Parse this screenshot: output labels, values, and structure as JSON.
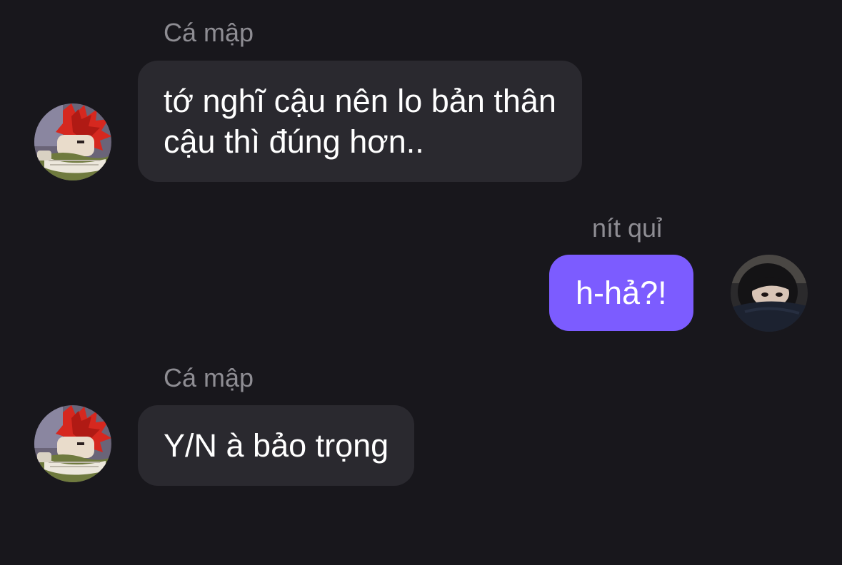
{
  "messages": [
    {
      "sender": "Cá mập",
      "direction": "incoming",
      "avatar_icon": "red-spiky-hair-anime-avatar",
      "lines": [
        "tớ nghĩ cậu nên lo bản thân",
        "cậu thì đúng hơn.."
      ]
    },
    {
      "sender": "nít quỉ",
      "direction": "outgoing",
      "avatar_icon": "dark-hair-girl-photo-avatar",
      "lines": [
        "h-hả?!"
      ]
    },
    {
      "sender": "Cá mập",
      "direction": "incoming",
      "avatar_icon": "red-spiky-hair-anime-avatar",
      "lines": [
        "Y/N à bảo trọng"
      ]
    }
  ],
  "colors": {
    "background": "#18171c",
    "incoming_bubble": "#2a292f",
    "outgoing_bubble": "#7c5cff",
    "sender_name": "#8e8d93",
    "message_text": "#ffffff"
  }
}
